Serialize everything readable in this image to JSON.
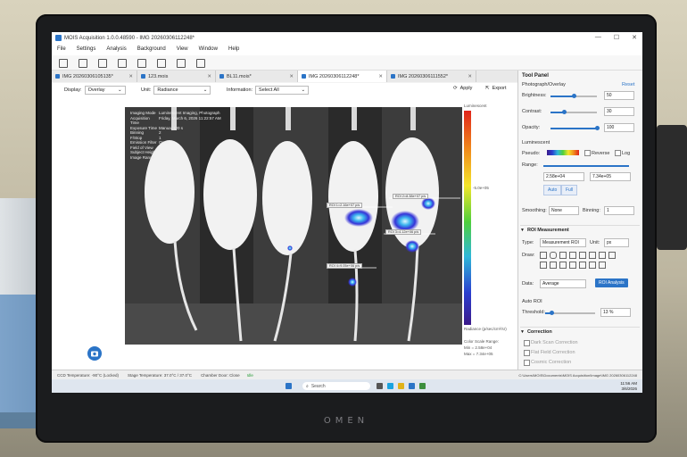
{
  "app": {
    "title": "MOIS Acquisition 1.0.0.48590 - IMG 20260306112248*",
    "window_controls": [
      "—",
      "☐",
      "✕"
    ]
  },
  "menu": [
    "File",
    "Settings",
    "Analysis",
    "Background",
    "View",
    "Window",
    "Help"
  ],
  "tabs": [
    {
      "label": "IMG 20260306105135*",
      "active": false
    },
    {
      "label": "123.mois",
      "active": false
    },
    {
      "label": "BL11.mois*",
      "active": false
    },
    {
      "label": "IMG 20260306112248*",
      "active": true
    },
    {
      "label": "IMG 20260306111552*",
      "active": false
    }
  ],
  "controls": {
    "display_label": "Display:",
    "display_value": "Overlay",
    "unit_label": "Unit:",
    "unit_value": "Radiance",
    "information_label": "Information:",
    "information_value": "Select All",
    "apply_label": "Apply",
    "export_label": "Export"
  },
  "image_info": [
    {
      "k": "Imaging Mode",
      "v": "Luminescent Imaging, Photograph"
    },
    {
      "k": "Acquisition Time",
      "v": "Friday, March 6, 2026 11:22:57 AM"
    },
    {
      "k": "Exposure Time",
      "v": "Manual 120 s"
    },
    {
      "k": "Binning",
      "v": "2"
    },
    {
      "k": "F/Stop",
      "v": "1"
    },
    {
      "k": "Emission Filter",
      "v": "Open"
    },
    {
      "k": "Field of View",
      "v": ""
    },
    {
      "k": "Subject Height",
      "v": ""
    },
    {
      "k": "Image Range",
      "v": ""
    }
  ],
  "colorbar": {
    "top_label": "Luminescent",
    "mid_label": "-5.0e+05",
    "unit_label": "Radiance (p/sec/cm²/sr)",
    "color_scale_label": "Color Scale Range:",
    "min_label": "Min = 2.58e+04",
    "max_label": "Max = 7.34e+05"
  },
  "rois": [
    {
      "label": "ROI 1=2.16e+07 p/s"
    },
    {
      "label": "ROI 2=8.38e+07 p/s"
    },
    {
      "label": "ROI 3=4.12e+06 p/s"
    },
    {
      "label": "ROI 4=9.05e+06 p/s"
    }
  ],
  "tool_panel": {
    "title": "Tool Panel",
    "section_photo": "Photograph/Overlay",
    "reset_label": "Reset",
    "brightness_label": "Brightness:",
    "brightness_value": "50",
    "brightness_frac": 0.5,
    "contrast_label": "Contrast:",
    "contrast_value": "30",
    "contrast_frac": 0.3,
    "opacity_label": "Opacity:",
    "opacity_value": "100",
    "opacity_frac": 1.0,
    "luminescent_label": "Luminescent",
    "pseudo_label": "Pseudo:",
    "reverse_label": "Reverse",
    "log_label": "Log",
    "range_label": "Range:",
    "range_min": "2.58e+04",
    "range_max": "7.34e+05",
    "auto_label": "Auto",
    "full_label": "Full",
    "smoothing_label": "Smoothing:",
    "smoothing_value": "None",
    "binning_label": "Binning:",
    "binning_value": "1",
    "roi_section": "ROI Measurement",
    "type_label": "Type:",
    "type_value": "Measurement ROI",
    "unit_label": "Unit:",
    "unit_value": "px",
    "draw_label": "Draw:",
    "data_label": "Data:",
    "data_value": "Average",
    "roi_analysis_label": "ROI Analysis",
    "auto_roi_label": "Auto ROI",
    "threshold_label": "Threshold:",
    "threshold_value": "13 %",
    "threshold_frac": 0.13,
    "correction_label": "Correction",
    "corr_items": [
      "Dark Scan Correction",
      "Flat Field Correction",
      "Cosmic Correction"
    ]
  },
  "status": {
    "ccd_temp": "CCD Temperature: -90°C (Locked)",
    "stage_temp": "Stage Temperature: 37.0°C / 37.0°C",
    "chamber": "Chamber Door: Close",
    "idle": "Idle",
    "path": "C:\\Users\\MOIS\\Documents\\MOIS Acquisition\\Image\\IMG 20260306112248"
  },
  "taskbar": {
    "search_placeholder": "Search",
    "time": "11:56 AM",
    "date": "3/6/2026"
  },
  "device_brand": "OMEN",
  "colors": {
    "accent": "#2b74c7",
    "bezel": "#1b1c1e"
  }
}
